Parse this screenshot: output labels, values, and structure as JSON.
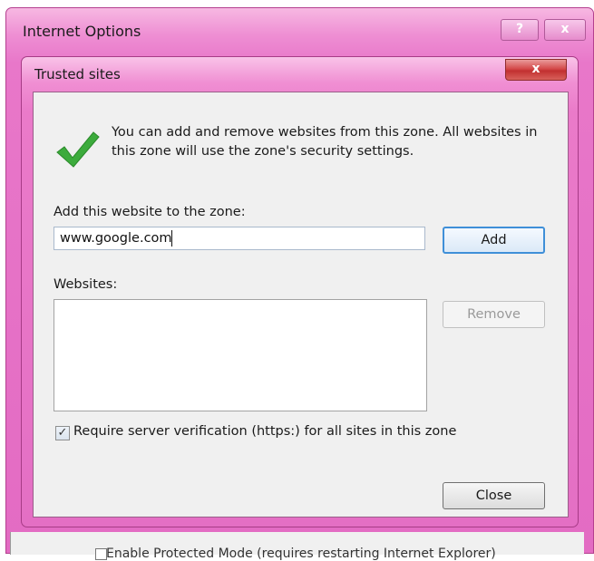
{
  "parent_window": {
    "title": "Internet Options",
    "help_symbol": "?",
    "close_symbol": "x",
    "partial_hidden_text": "Enable Protected Mode (requires restarting Internet Explorer)"
  },
  "dialog": {
    "title": "Trusted sites",
    "close_symbol": "x",
    "icon": "green-check-icon",
    "intro_text": "You can add and remove websites from this zone. All websites in this zone will use the zone's security settings.",
    "add_label": "Add this website to the zone:",
    "url_value": "www.google.com",
    "add_button": "Add",
    "websites_label": "Websites:",
    "websites": [],
    "remove_button": "Remove",
    "require_verification_label": "Require server verification (https:) for all sites in this zone",
    "require_verification_checked": true,
    "close_button": "Close"
  },
  "colors": {
    "window_frame": "#e877c9",
    "check_green": "#3cab3c",
    "focus_blue": "#3f8fd8",
    "close_red": "#c23030"
  }
}
